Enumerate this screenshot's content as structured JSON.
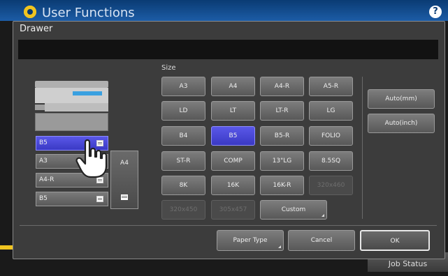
{
  "app": {
    "title": "User Functions",
    "help_symbol": "?"
  },
  "dialog": {
    "title": "Drawer",
    "message": ""
  },
  "drawers": [
    {
      "label": "B5",
      "selected": true
    },
    {
      "label": "A3",
      "selected": false
    },
    {
      "label": "A4-R",
      "selected": false
    },
    {
      "label": "B5",
      "selected": false
    }
  ],
  "bypass": {
    "label": "A4"
  },
  "size": {
    "label": "Size",
    "buttons": [
      [
        "A3",
        "A4",
        "A4-R",
        "A5-R"
      ],
      [
        "LD",
        "LT",
        "LT-R",
        "LG"
      ],
      [
        "B4",
        "B5",
        "B5-R",
        "FOLIO"
      ],
      [
        "ST-R",
        "COMP",
        "13\"LG",
        "8.5SQ"
      ],
      [
        "8K",
        "16K",
        "16K-R",
        "320x460"
      ],
      [
        "320x450",
        "305x457"
      ]
    ],
    "selected": "B5",
    "disabled": [
      "320x460",
      "320x450",
      "305x457"
    ],
    "custom_label": "Custom"
  },
  "auto": {
    "mm_label": "Auto(mm)",
    "inch_label": "Auto(inch)"
  },
  "footer": {
    "paper_type_label": "Paper Type",
    "cancel_label": "Cancel",
    "ok_label": "OK"
  },
  "job_status_label": "Job Status",
  "colors": {
    "accent_blue": "#3a39c4",
    "header_blue": "#1c5ca6",
    "gear_yellow": "#f0c420"
  }
}
